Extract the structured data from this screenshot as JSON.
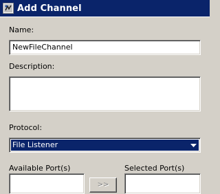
{
  "window": {
    "title": "Add Channel",
    "icon": "channel-app-icon"
  },
  "form": {
    "name_label": "Name:",
    "name_value": "NewFileChannel",
    "description_label": "Description:",
    "description_value": "",
    "protocol_label": "Protocol:",
    "protocol_value": "File Listener",
    "available_ports_label": "Available Port(s)",
    "selected_ports_label": "Selected Port(s)",
    "move_button_label": ">>"
  },
  "colors": {
    "dialog_background": "#d4d0c8",
    "titlebar": "#0a246a",
    "selection": "#0a246a"
  }
}
